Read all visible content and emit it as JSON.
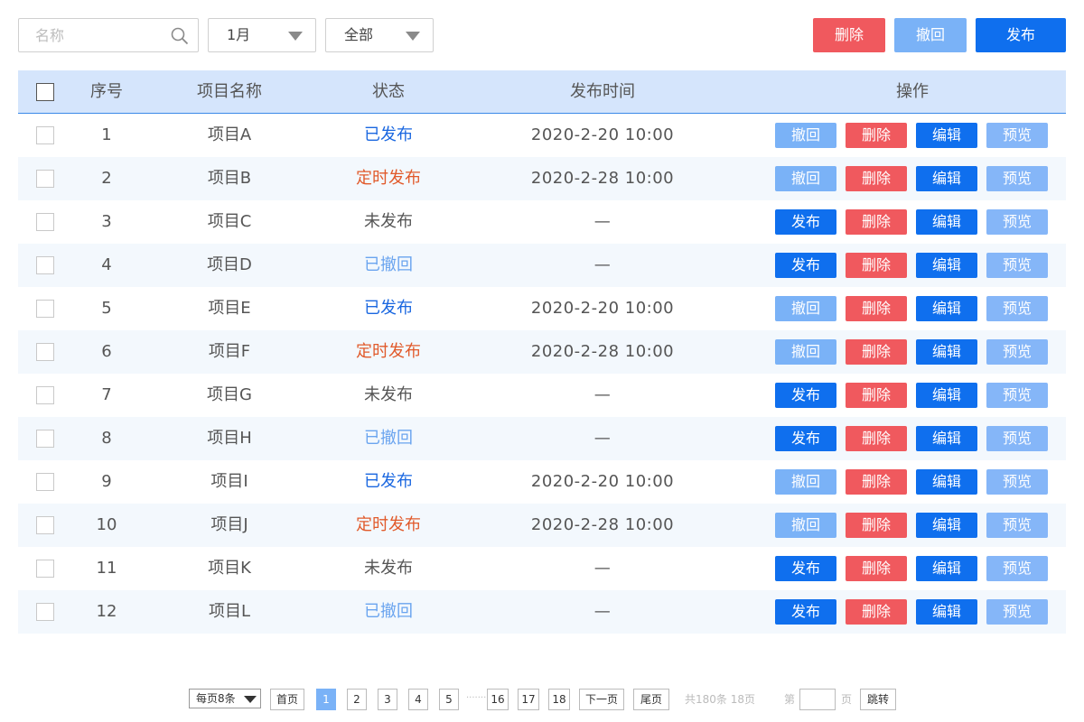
{
  "toolbar": {
    "search_placeholder": "名称",
    "month_value": "1月",
    "status_value": "全部",
    "delete_label": "删除",
    "revoke_label": "撤回",
    "publish_label": "发布"
  },
  "table": {
    "headers": [
      "序号",
      "项目名称",
      "状态",
      "发布时间",
      "操作"
    ],
    "rows": [
      {
        "no": "1",
        "name": "项目A",
        "status": "已发布",
        "status_type": "published",
        "time": "2020-2-20  10:00",
        "op1": "撤回"
      },
      {
        "no": "2",
        "name": "项目B",
        "status": "定时发布",
        "status_type": "scheduled",
        "time": "2020-2-28  10:00",
        "op1": "撤回"
      },
      {
        "no": "3",
        "name": "项目C",
        "status": "未发布",
        "status_type": "unpublished",
        "time": "—",
        "op1": "发布"
      },
      {
        "no": "4",
        "name": "项目D",
        "status": "已撤回",
        "status_type": "revoked",
        "time": "—",
        "op1": "发布"
      },
      {
        "no": "5",
        "name": "项目E",
        "status": "已发布",
        "status_type": "published",
        "time": "2020-2-20  10:00",
        "op1": "撤回"
      },
      {
        "no": "6",
        "name": "项目F",
        "status": "定时发布",
        "status_type": "scheduled",
        "time": "2020-2-28  10:00",
        "op1": "撤回"
      },
      {
        "no": "7",
        "name": "项目G",
        "status": "未发布",
        "status_type": "unpublished",
        "time": "—",
        "op1": "发布"
      },
      {
        "no": "8",
        "name": "项目H",
        "status": "已撤回",
        "status_type": "revoked",
        "time": "—",
        "op1": "发布"
      },
      {
        "no": "9",
        "name": "项目I",
        "status": "已发布",
        "status_type": "published",
        "time": "2020-2-20  10:00",
        "op1": "撤回"
      },
      {
        "no": "10",
        "name": "项目J",
        "status": "定时发布",
        "status_type": "scheduled",
        "time": "2020-2-28  10:00",
        "op1": "撤回"
      },
      {
        "no": "11",
        "name": "项目K",
        "status": "未发布",
        "status_type": "unpublished",
        "time": "—",
        "op1": "发布"
      },
      {
        "no": "12",
        "name": "项目L",
        "status": "已撤回",
        "status_type": "revoked",
        "time": "—",
        "op1": "发布"
      }
    ],
    "op_delete": "删除",
    "op_edit": "编辑",
    "op_preview": "预览"
  },
  "pagination": {
    "per_page": "每页8条",
    "first": "首页",
    "pages": [
      "1",
      "2",
      "3",
      "4",
      "5"
    ],
    "ellipsis": "·······",
    "tail_pages": [
      "16",
      "17",
      "18"
    ],
    "current_page": "1",
    "next": "下一页",
    "last": "尾页",
    "summary": "共180条 18页",
    "goto_prefix": "第",
    "goto_suffix": "页",
    "jump": "跳转"
  },
  "colors": {
    "primary": "#0f6fee",
    "light_primary": "#7ab2f7",
    "danger": "#f0595e",
    "header_bg": "#d5e5fc",
    "row_alt_bg": "#f3f8fd",
    "status_published": "#1a67e0",
    "status_scheduled": "#e15a2b",
    "status_revoked": "#6aa4ef"
  }
}
